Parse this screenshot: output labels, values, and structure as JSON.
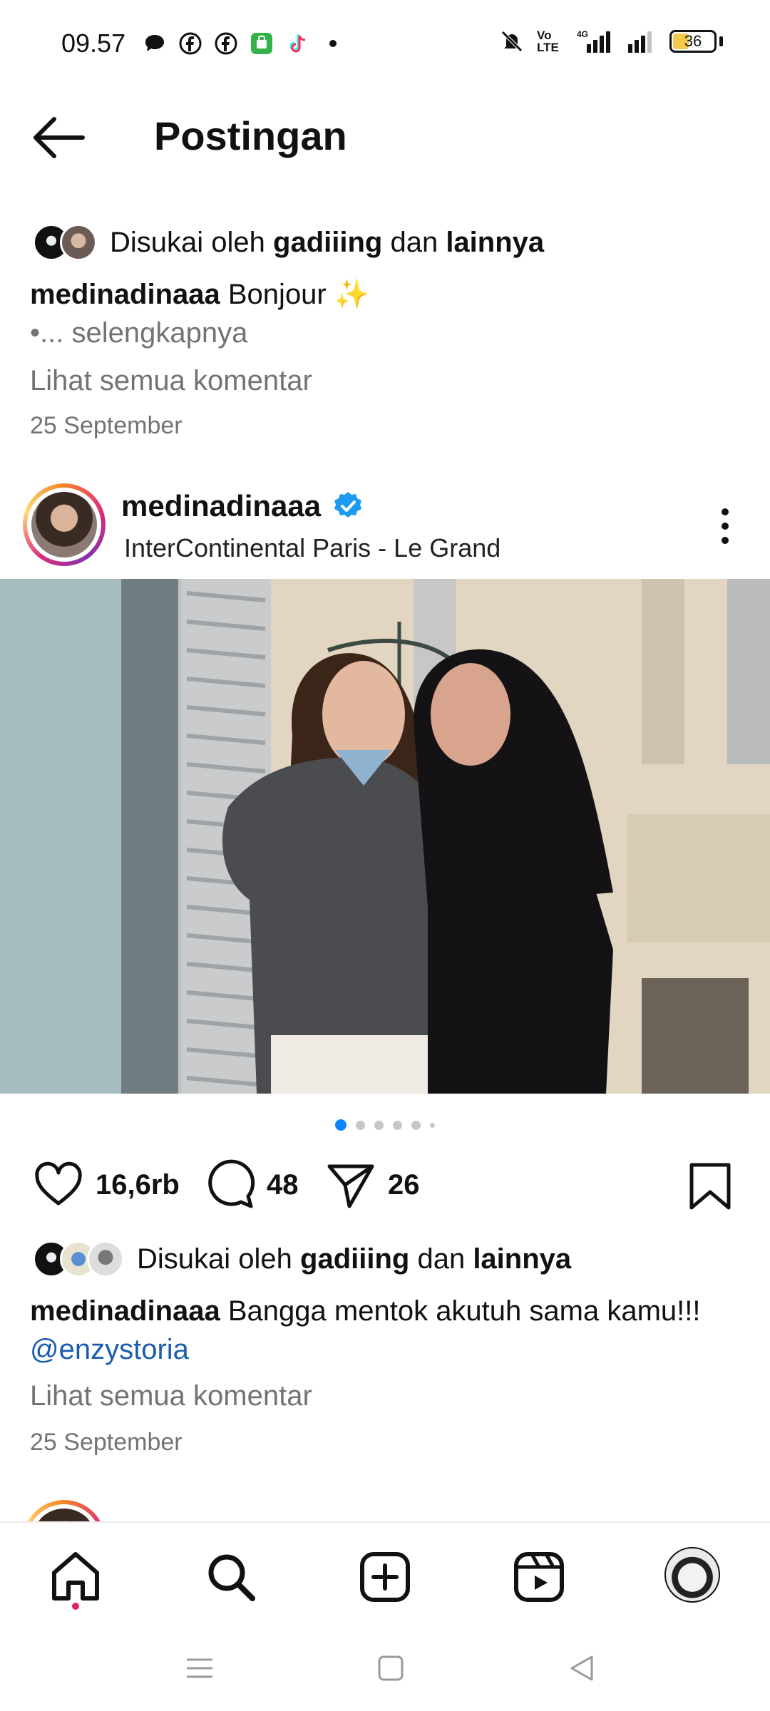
{
  "status_bar": {
    "time": "09.57",
    "notification_icons": [
      "chat-bubble-icon",
      "facebook-icon",
      "facebook-icon",
      "app-icon",
      "tiktok-icon",
      "more-dot-icon"
    ],
    "network_label_1": "Vo LTE",
    "network_label_2": "4G",
    "battery": "36"
  },
  "header": {
    "title": "Postingan"
  },
  "prev_post": {
    "liked_prefix": "Disukai oleh ",
    "liked_user": "gadiiing",
    "liked_mid": " dan ",
    "liked_others": "lainnya",
    "caption_user": "medinadinaaa",
    "caption_text": " Bonjour ✨",
    "more_text": "•... selengkapnya",
    "comments_link": "Lihat semua komentar",
    "date": "25 September"
  },
  "post": {
    "username": "medinadinaaa",
    "location": "InterContinental Paris - Le Grand",
    "carousel_count": 6,
    "carousel_active": 1,
    "likes": "16,6rb",
    "comments": "48",
    "shares": "26",
    "liked_prefix": "Disukai oleh ",
    "liked_user": "gadiiing",
    "liked_mid": " dan ",
    "liked_others": "lainnya",
    "caption_user": "medinadinaaa",
    "caption_text": " Bangga mentok akutuh sama kamu!!!",
    "caption_mention": "@enzystoria",
    "comments_link": "Lihat semua komentar",
    "date": "25 September"
  },
  "bottom_nav": {
    "items": [
      "home-icon",
      "search-icon",
      "create-icon",
      "reels-icon",
      "profile-avatar"
    ]
  },
  "colors": {
    "link": "#1b5cae",
    "muted": "#737373",
    "carousel_active": "#0a84ff",
    "notification_dot": "#e0245e"
  }
}
